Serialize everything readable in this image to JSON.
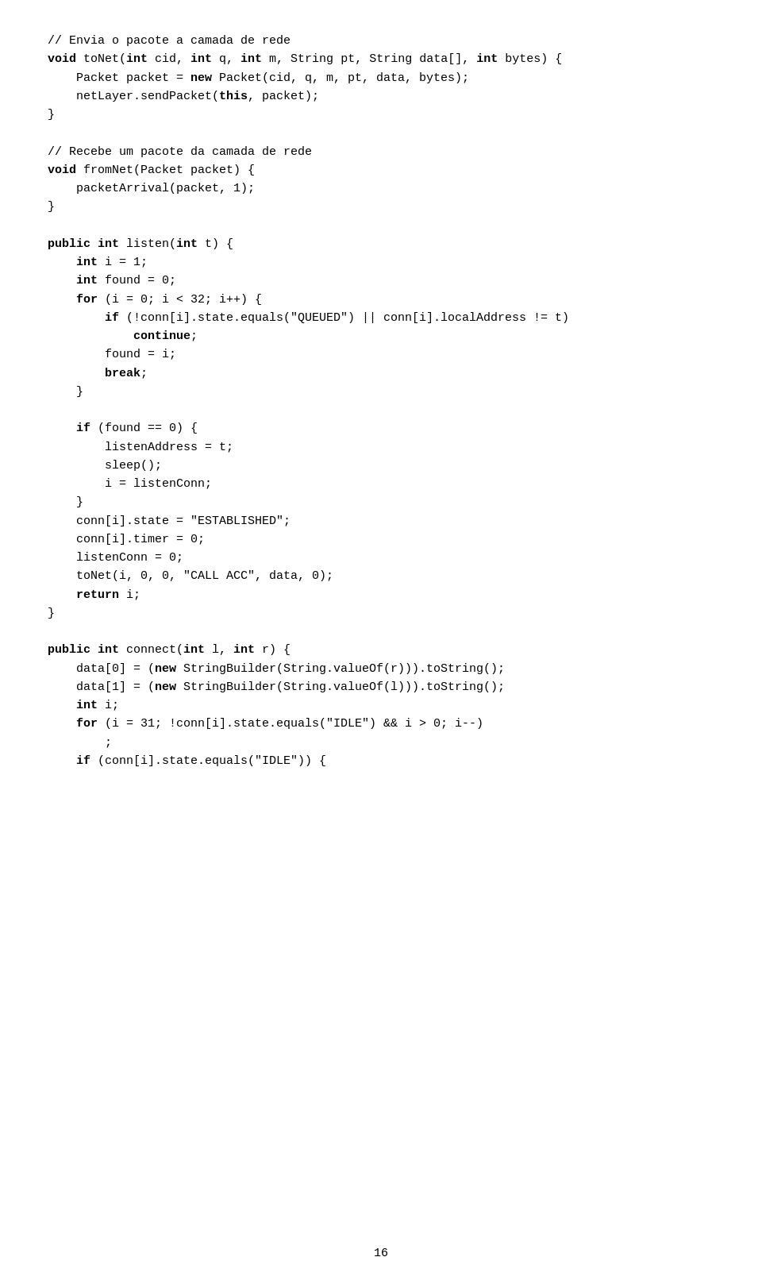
{
  "page": {
    "number": "16",
    "code_lines": [
      {
        "id": 1,
        "text": "// Envia o pacote a camada de rede",
        "bold_words": []
      },
      {
        "id": 2,
        "text": "void toNet(int cid, int q, int m, String pt, String data[], int bytes) {",
        "bold_words": [
          "void",
          "int",
          "int",
          "int",
          "int"
        ]
      },
      {
        "id": 3,
        "text": "    Packet packet = new Packet(cid, q, m, pt, data, bytes);",
        "bold_words": [
          "new"
        ]
      },
      {
        "id": 4,
        "text": "    netLayer.sendPacket(this, packet);",
        "bold_words": []
      },
      {
        "id": 5,
        "text": "}",
        "bold_words": []
      },
      {
        "id": 6,
        "text": "",
        "bold_words": []
      },
      {
        "id": 7,
        "text": "// Recebe um pacote da camada de rede",
        "bold_words": []
      },
      {
        "id": 8,
        "text": "void fromNet(Packet packet) {",
        "bold_words": [
          "void"
        ]
      },
      {
        "id": 9,
        "text": "    packetArrival(packet, 1);",
        "bold_words": []
      },
      {
        "id": 10,
        "text": "}",
        "bold_words": []
      },
      {
        "id": 11,
        "text": "",
        "bold_words": []
      },
      {
        "id": 12,
        "text": "public int listen(int t) {",
        "bold_words": [
          "public",
          "int",
          "int"
        ]
      },
      {
        "id": 13,
        "text": "    int i = 1;",
        "bold_words": [
          "int"
        ]
      },
      {
        "id": 14,
        "text": "    int found = 0;",
        "bold_words": [
          "int"
        ]
      },
      {
        "id": 15,
        "text": "    for (i = 0; i < 32; i++) {",
        "bold_words": [
          "for"
        ]
      },
      {
        "id": 16,
        "text": "        if (!conn[i].state.equals(\"QUEUED\") || conn[i].localAddress != t)",
        "bold_words": [
          "if"
        ]
      },
      {
        "id": 17,
        "text": "            continue;",
        "bold_words": [
          "continue"
        ]
      },
      {
        "id": 18,
        "text": "        found = i;",
        "bold_words": []
      },
      {
        "id": 19,
        "text": "        break;",
        "bold_words": [
          "break"
        ]
      },
      {
        "id": 20,
        "text": "    }",
        "bold_words": []
      },
      {
        "id": 21,
        "text": "",
        "bold_words": []
      },
      {
        "id": 22,
        "text": "    if (found == 0) {",
        "bold_words": [
          "if"
        ]
      },
      {
        "id": 23,
        "text": "        listenAddress = t;",
        "bold_words": []
      },
      {
        "id": 24,
        "text": "        sleep();",
        "bold_words": []
      },
      {
        "id": 25,
        "text": "        i = listenConn;",
        "bold_words": []
      },
      {
        "id": 26,
        "text": "    }",
        "bold_words": []
      },
      {
        "id": 27,
        "text": "    conn[i].state = \"ESTABLISHED\";",
        "bold_words": []
      },
      {
        "id": 28,
        "text": "    conn[i].timer = 0;",
        "bold_words": []
      },
      {
        "id": 29,
        "text": "    listenConn = 0;",
        "bold_words": []
      },
      {
        "id": 30,
        "text": "    toNet(i, 0, 0, \"CALL ACC\", data, 0);",
        "bold_words": []
      },
      {
        "id": 31,
        "text": "    return i;",
        "bold_words": [
          "return"
        ]
      },
      {
        "id": 32,
        "text": "}",
        "bold_words": []
      },
      {
        "id": 33,
        "text": "",
        "bold_words": []
      },
      {
        "id": 34,
        "text": "public int connect(int l, int r) {",
        "bold_words": [
          "public",
          "int",
          "int",
          "int"
        ]
      },
      {
        "id": 35,
        "text": "    data[0] = (new StringBuilder(String.valueOf(r))).toString();",
        "bold_words": [
          "new"
        ]
      },
      {
        "id": 36,
        "text": "    data[1] = (new StringBuilder(String.valueOf(l))).toString();",
        "bold_words": [
          "new"
        ]
      },
      {
        "id": 37,
        "text": "    int i;",
        "bold_words": [
          "int"
        ]
      },
      {
        "id": 38,
        "text": "    for (i = 31; !conn[i].state.equals(\"IDLE\") && i > 0; i--)",
        "bold_words": [
          "for"
        ]
      },
      {
        "id": 39,
        "text": "        ;",
        "bold_words": []
      },
      {
        "id": 40,
        "text": "    if (conn[i].state.equals(\"IDLE\")) {",
        "bold_words": [
          "if"
        ]
      }
    ]
  }
}
